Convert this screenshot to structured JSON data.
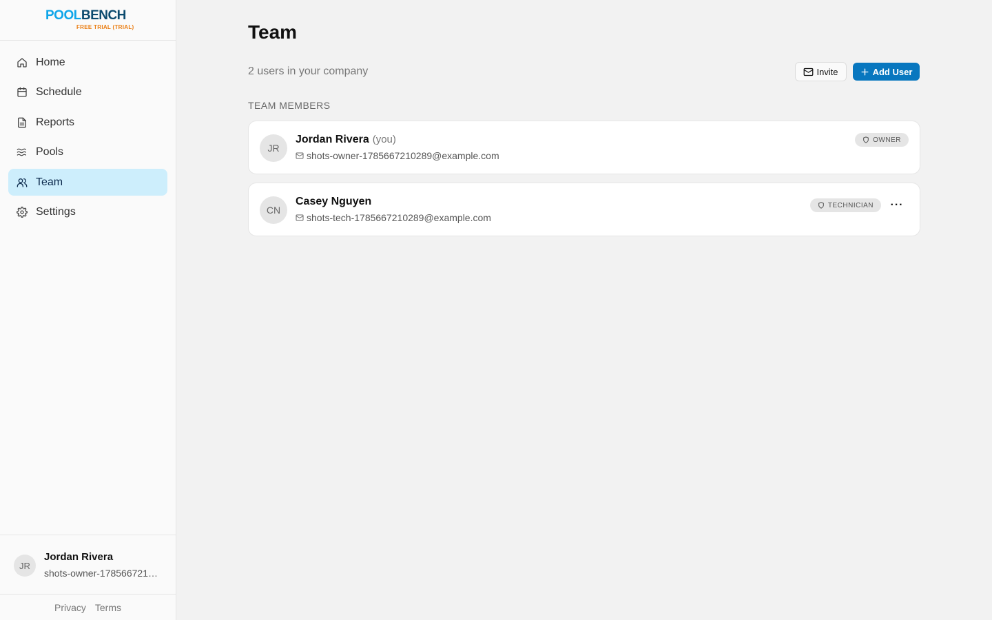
{
  "brand": {
    "logo_part1": "POOL",
    "logo_part2": "BENCH",
    "trial_label": "FREE TRIAL (TRIAL)"
  },
  "sidebar": {
    "items": [
      {
        "label": "Home",
        "icon": "home-icon"
      },
      {
        "label": "Schedule",
        "icon": "calendar-icon"
      },
      {
        "label": "Reports",
        "icon": "document-icon"
      },
      {
        "label": "Pools",
        "icon": "waves-icon"
      },
      {
        "label": "Team",
        "icon": "users-icon",
        "active": true
      },
      {
        "label": "Settings",
        "icon": "gear-icon"
      }
    ],
    "user": {
      "initials": "JR",
      "name": "Jordan Rivera",
      "email": "shots-owner-1785667210289@example.com"
    },
    "legal": {
      "privacy": "Privacy",
      "terms": "Terms"
    }
  },
  "main": {
    "title": "Team",
    "subtitle": "2 users in your company",
    "invite_label": "Invite",
    "add_user_label": "Add User",
    "section_label": "TEAM MEMBERS",
    "members": [
      {
        "initials": "JR",
        "name": "Jordan Rivera",
        "you_label": "(you)",
        "email": "shots-owner-1785667210289@example.com",
        "role": "OWNER"
      },
      {
        "initials": "CN",
        "name": "Casey Nguyen",
        "email": "shots-tech-1785667210289@example.com",
        "role": "TECHNICIAN",
        "more_label": "···"
      }
    ]
  },
  "colors": {
    "accent": "#0877bf",
    "active_nav_bg": "#cdeefc",
    "logo_light": "#0ea5e9",
    "logo_dark": "#0c4a6e",
    "trial": "#ea7a0c"
  }
}
